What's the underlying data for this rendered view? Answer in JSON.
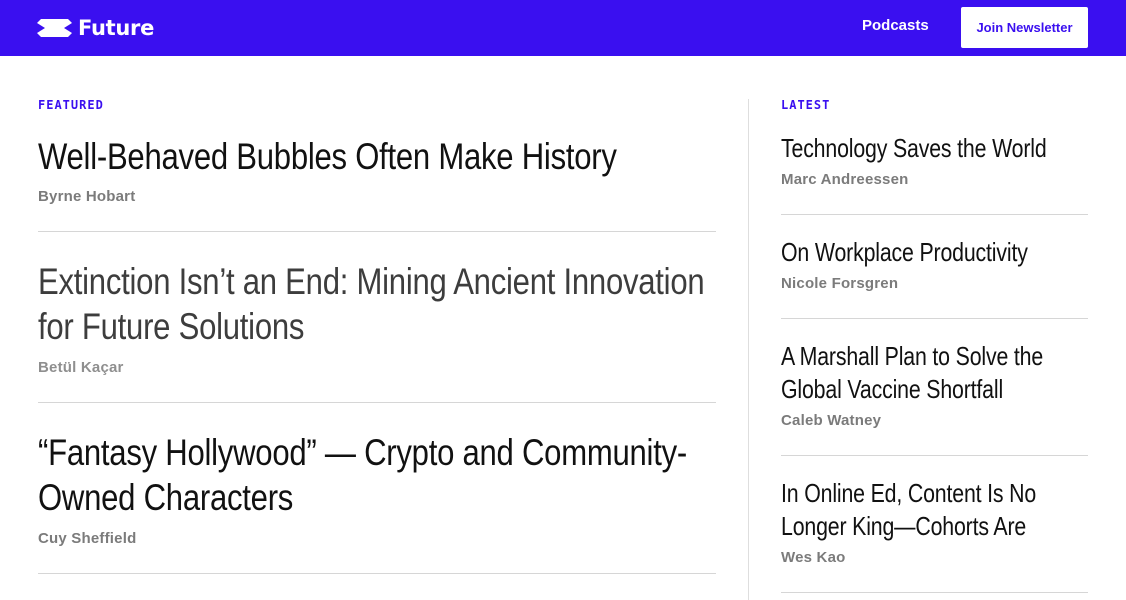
{
  "header": {
    "logo_text": "Future",
    "nav_podcasts": "Podcasts",
    "join_button": "Join Newsletter",
    "brand_color": "#3a0ff0"
  },
  "featured": {
    "label": "FEATURED",
    "articles": [
      {
        "title": "Well-Behaved Bubbles Often Make History",
        "author": "Byrne Hobart"
      },
      {
        "title": "Extinction Isn’t an End: Mining Ancient Innovation for Future Solutions",
        "author": "Betül Kaçar"
      },
      {
        "title": "“Fantasy Hollywood” — Crypto and Community-Owned Characters",
        "author": "Cuy Sheffield"
      }
    ]
  },
  "latest": {
    "label": "LATEST",
    "articles": [
      {
        "title": "Technology Saves the World",
        "author": "Marc Andreessen"
      },
      {
        "title": "On Workplace Productivity",
        "author": "Nicole Forsgren"
      },
      {
        "title": "A Marshall Plan to Solve the Global Vaccine Shortfall",
        "author": "Caleb Watney"
      },
      {
        "title": "In Online Ed, Content Is No Longer King—Cohorts Are",
        "author": "Wes Kao"
      }
    ]
  }
}
